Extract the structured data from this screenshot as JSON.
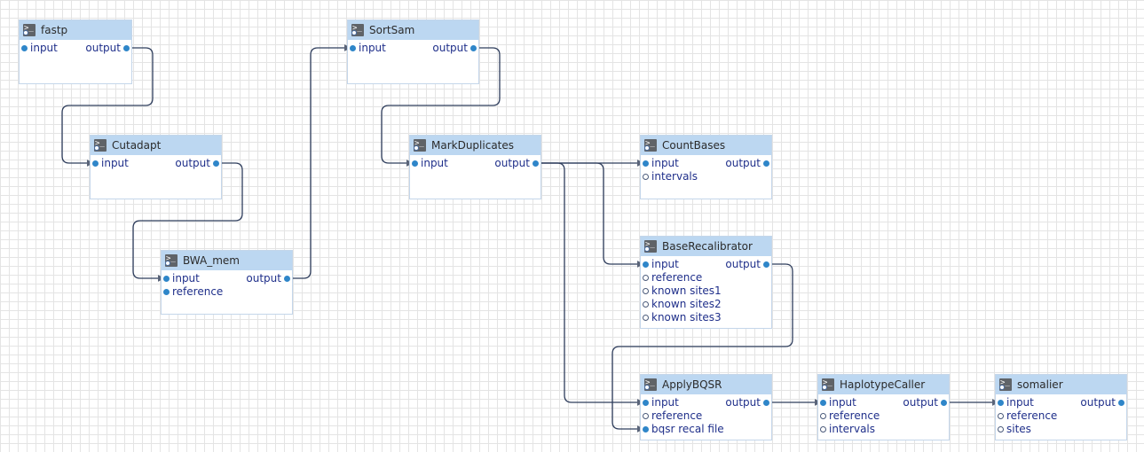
{
  "nodes": [
    {
      "id": "fastp",
      "title": "fastp",
      "inputs": [
        {
          "label": "input",
          "connected": true
        }
      ],
      "outputs": [
        {
          "label": "output",
          "connected": true
        }
      ]
    },
    {
      "id": "cutadapt",
      "title": "Cutadapt",
      "inputs": [
        {
          "label": "input",
          "connected": true
        }
      ],
      "outputs": [
        {
          "label": "output",
          "connected": true
        }
      ]
    },
    {
      "id": "bwa_mem",
      "title": "BWA_mem",
      "inputs": [
        {
          "label": "input",
          "connected": true
        },
        {
          "label": "reference",
          "connected": true
        }
      ],
      "outputs": [
        {
          "label": "output",
          "connected": true
        }
      ]
    },
    {
      "id": "sortsam",
      "title": "SortSam",
      "inputs": [
        {
          "label": "input",
          "connected": true
        }
      ],
      "outputs": [
        {
          "label": "output",
          "connected": true
        }
      ]
    },
    {
      "id": "markduplicates",
      "title": "MarkDuplicates",
      "inputs": [
        {
          "label": "input",
          "connected": true
        }
      ],
      "outputs": [
        {
          "label": "output",
          "connected": true
        }
      ]
    },
    {
      "id": "countbases",
      "title": "CountBases",
      "inputs": [
        {
          "label": "input",
          "connected": true
        },
        {
          "label": "intervals",
          "connected": false
        }
      ],
      "outputs": [
        {
          "label": "output",
          "connected": true
        }
      ]
    },
    {
      "id": "baserecalibrator",
      "title": "BaseRecalibrator",
      "inputs": [
        {
          "label": "input",
          "connected": true
        },
        {
          "label": "reference",
          "connected": false
        },
        {
          "label": "known sites1",
          "connected": false
        },
        {
          "label": "known sites2",
          "connected": false
        },
        {
          "label": "known sites3",
          "connected": false
        }
      ],
      "outputs": [
        {
          "label": "output",
          "connected": true
        }
      ]
    },
    {
      "id": "applybqsr",
      "title": "ApplyBQSR",
      "inputs": [
        {
          "label": "input",
          "connected": true
        },
        {
          "label": "reference",
          "connected": false
        },
        {
          "label": "bqsr recal file",
          "connected": true
        }
      ],
      "outputs": [
        {
          "label": "output",
          "connected": true
        }
      ]
    },
    {
      "id": "haplotypecaller",
      "title": "HaplotypeCaller",
      "inputs": [
        {
          "label": "input",
          "connected": true
        },
        {
          "label": "reference",
          "connected": false
        },
        {
          "label": "intervals",
          "connected": false
        }
      ],
      "outputs": [
        {
          "label": "output",
          "connected": true
        }
      ]
    },
    {
      "id": "somalier",
      "title": "somalier",
      "inputs": [
        {
          "label": "input",
          "connected": true
        },
        {
          "label": "reference",
          "connected": false
        },
        {
          "label": "sites",
          "connected": false
        }
      ],
      "outputs": [
        {
          "label": "output",
          "connected": true
        }
      ]
    }
  ],
  "edges": [
    {
      "from": "fastp",
      "from_port": 0,
      "to": "cutadapt",
      "to_port": 0
    },
    {
      "from": "cutadapt",
      "from_port": 0,
      "to": "bwa_mem",
      "to_port": 0
    },
    {
      "from": "bwa_mem",
      "from_port": 0,
      "to": "sortsam",
      "to_port": 0
    },
    {
      "from": "sortsam",
      "from_port": 0,
      "to": "markduplicates",
      "to_port": 0
    },
    {
      "from": "markduplicates",
      "from_port": 0,
      "to": "countbases",
      "to_port": 0
    },
    {
      "from": "markduplicates",
      "from_port": 0,
      "to": "baserecalibrator",
      "to_port": 0
    },
    {
      "from": "markduplicates",
      "from_port": 0,
      "to": "applybqsr",
      "to_port": 0
    },
    {
      "from": "baserecalibrator",
      "from_port": 0,
      "to": "applybqsr",
      "to_port": 2
    },
    {
      "from": "applybqsr",
      "from_port": 0,
      "to": "haplotypecaller",
      "to_port": 0
    },
    {
      "from": "haplotypecaller",
      "from_port": 0,
      "to": "somalier",
      "to_port": 0
    }
  ],
  "icon": "terminal-icon",
  "colors": {
    "header": "#bcd7f1",
    "port_text": "#1f2f8a",
    "port_dot": "#2f86c9",
    "edge": "#2e3d5c"
  }
}
